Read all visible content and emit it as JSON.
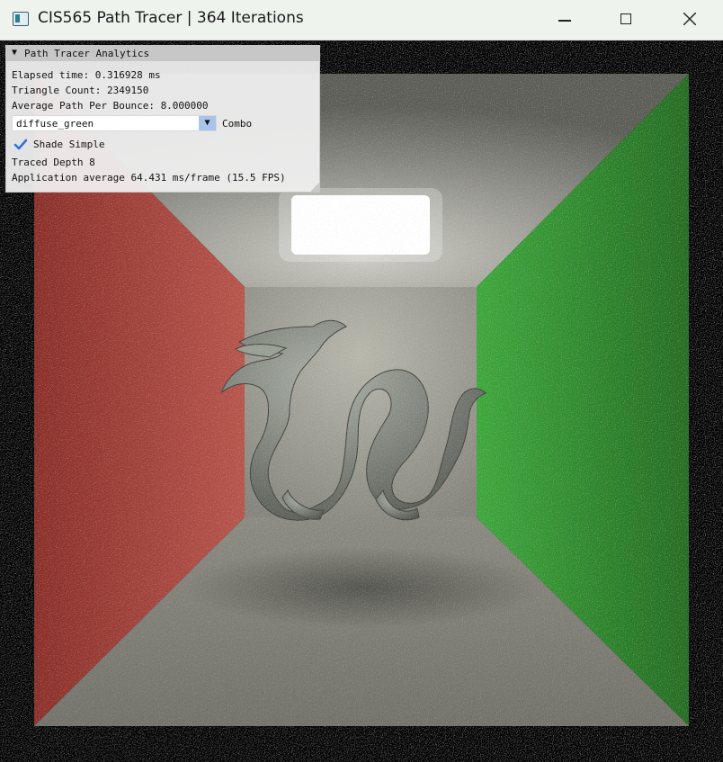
{
  "window": {
    "title": "CIS565 Path Tracer | 364 Iterations",
    "icon": "app-window-icon",
    "controls": [
      "minimize-icon",
      "maximize-icon",
      "close-icon"
    ]
  },
  "panel": {
    "title": "Path Tracer Analytics",
    "collapse_glyph": "▼",
    "elapsed_time": "Elapsed time: 0.316928 ms",
    "triangle_count": "Triangle Count: 2349150",
    "avg_path": "Average Path Per Bounce: 8.000000",
    "combo": {
      "value": "diffuse_green",
      "arrow": "▼",
      "label": "Combo"
    },
    "shade_simple": {
      "label": "Shade Simple",
      "checked": true
    },
    "traced_depth": "Traced Depth 8",
    "app_average": "Application average 64.431 ms/frame (15.5 FPS)"
  },
  "colors": {
    "left_wall": "#a33a30",
    "right_wall": "#2f8c2c",
    "back_wall": "#9c9c92",
    "light": "#ffffff",
    "accent": "#2f6ed8"
  }
}
